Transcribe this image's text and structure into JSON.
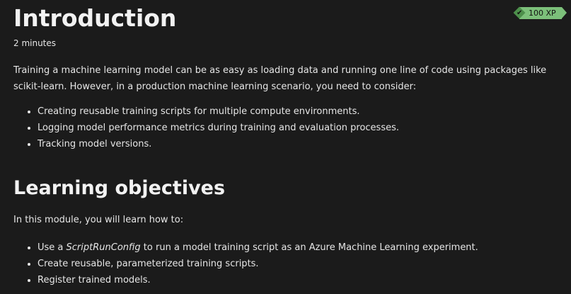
{
  "title": "Introduction",
  "duration": "2 minutes",
  "badge": {
    "label": "100 XP",
    "icon": "check-icon",
    "color": "#7cc07a"
  },
  "intro": "Training a machine learning model can be as easy as loading data and running one line of code using packages like scikit-learn. However, in a production machine learning scenario, you need to consider:",
  "considerations": [
    "Creating reusable training scripts for multiple compute environments.",
    "Logging model performance metrics during training and evaluation processes.",
    "Tracking model versions."
  ],
  "objectives": {
    "heading": "Learning objectives",
    "intro": "In this module, you will learn how to:",
    "item1_prefix": "Use a ",
    "item1_em": "ScriptRunConfig",
    "item1_suffix": " to run a model training script as an Azure Machine Learning experiment.",
    "item2": "Create reusable, parameterized training scripts.",
    "item3": "Register trained models."
  }
}
